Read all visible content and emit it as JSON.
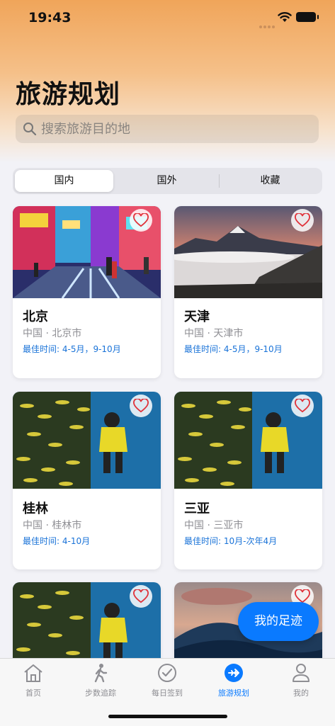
{
  "status": {
    "time": "19:43"
  },
  "header": {
    "title": "旅游规划"
  },
  "search": {
    "placeholder": "搜索旅游目的地"
  },
  "segments": [
    {
      "label": "国内",
      "active": true
    },
    {
      "label": "国外",
      "active": false
    },
    {
      "label": "收藏",
      "active": false
    }
  ],
  "destinations": [
    {
      "name": "北京",
      "location": "中国 · 北京市",
      "best_time": "最佳时间: 4-5月，9-10月",
      "image": "city-street"
    },
    {
      "name": "天津",
      "location": "中国 · 天津市",
      "best_time": "最佳时间: 4-5月，9-10月",
      "image": "mountain-clouds"
    },
    {
      "name": "桂林",
      "location": "中国 · 桂林市",
      "best_time": "最佳时间: 4-10月",
      "image": "diver-fish"
    },
    {
      "name": "三亚",
      "location": "中国 · 三亚市",
      "best_time": "最佳时间: 10月-次年4月",
      "image": "diver-fish"
    },
    {
      "name": "",
      "location": "",
      "best_time": "",
      "image": "diver-fish"
    },
    {
      "name": "",
      "location": "",
      "best_time": "",
      "image": "ocean-wave"
    }
  ],
  "fab": {
    "label": "我的足迹"
  },
  "tabbar": [
    {
      "label": "首页",
      "icon": "house-icon",
      "active": false
    },
    {
      "label": "步数追踪",
      "icon": "walking-icon",
      "active": false
    },
    {
      "label": "每日签到",
      "icon": "checkmark-circle-icon",
      "active": false
    },
    {
      "label": "旅游规划",
      "icon": "airplane-circle-icon",
      "active": true
    },
    {
      "label": "我的",
      "icon": "person-icon",
      "active": false
    }
  ],
  "colors": {
    "accent": "#0a7aff",
    "best_time": "#1a73d8",
    "heart": "#e0323a"
  }
}
